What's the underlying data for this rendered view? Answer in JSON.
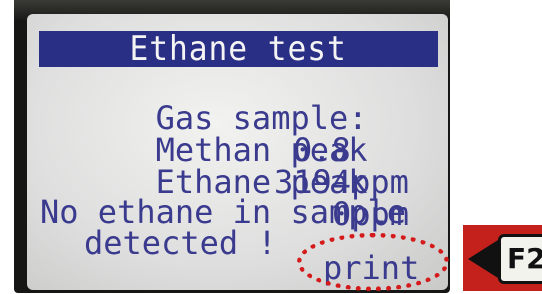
{
  "screen": {
    "title": "Ethane test",
    "rows": [
      {
        "label": "Gas sample:",
        "value": "0.8"
      },
      {
        "label": "Methan peak",
        "value": "3194ppm"
      },
      {
        "label": "Ethane peak",
        "value": "0ppm"
      }
    ],
    "message": {
      "line1": "No ethane in sample",
      "line2": "detected !"
    },
    "softkey_label": "print"
  },
  "hardware": {
    "key_label": "F2"
  },
  "colors": {
    "title_bar": "#2a2f86",
    "lcd_text": "#3a3a8e",
    "highlight": "#d41a1a",
    "key_panel": "#c4211c"
  }
}
